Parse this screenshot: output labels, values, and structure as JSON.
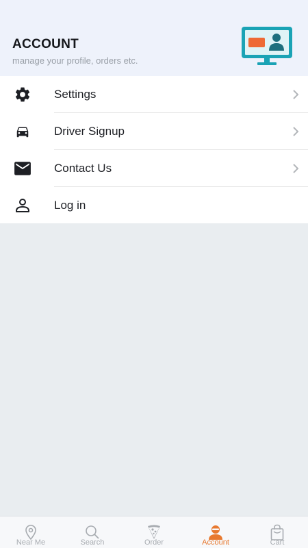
{
  "header": {
    "title": "ACCOUNT",
    "subtitle": "manage your profile, orders etc.",
    "illustration": "monitor-profile-icon"
  },
  "menu": {
    "items": [
      {
        "label": "Settings",
        "icon": "gear-icon",
        "has_chevron": true
      },
      {
        "label": "Driver Signup",
        "icon": "car-icon",
        "has_chevron": true
      },
      {
        "label": "Contact Us",
        "icon": "mail-icon",
        "has_chevron": true
      },
      {
        "label": "Log in",
        "icon": "person-icon",
        "has_chevron": false
      }
    ]
  },
  "bottom_nav": {
    "items": [
      {
        "label": "Near Me",
        "icon": "location-pin-icon",
        "active": false
      },
      {
        "label": "Search",
        "icon": "search-icon",
        "active": false
      },
      {
        "label": "Order",
        "icon": "pizza-slice-icon",
        "active": false
      },
      {
        "label": "Account",
        "icon": "user-avatar-icon",
        "active": true
      },
      {
        "label": "Cart",
        "icon": "shopping-bag-icon",
        "active": false
      }
    ]
  },
  "colors": {
    "accent": "#e8792f",
    "header_bg": "#eef2fb",
    "page_bg": "#e9edf0",
    "illustration_teal": "#1aa3b5"
  }
}
